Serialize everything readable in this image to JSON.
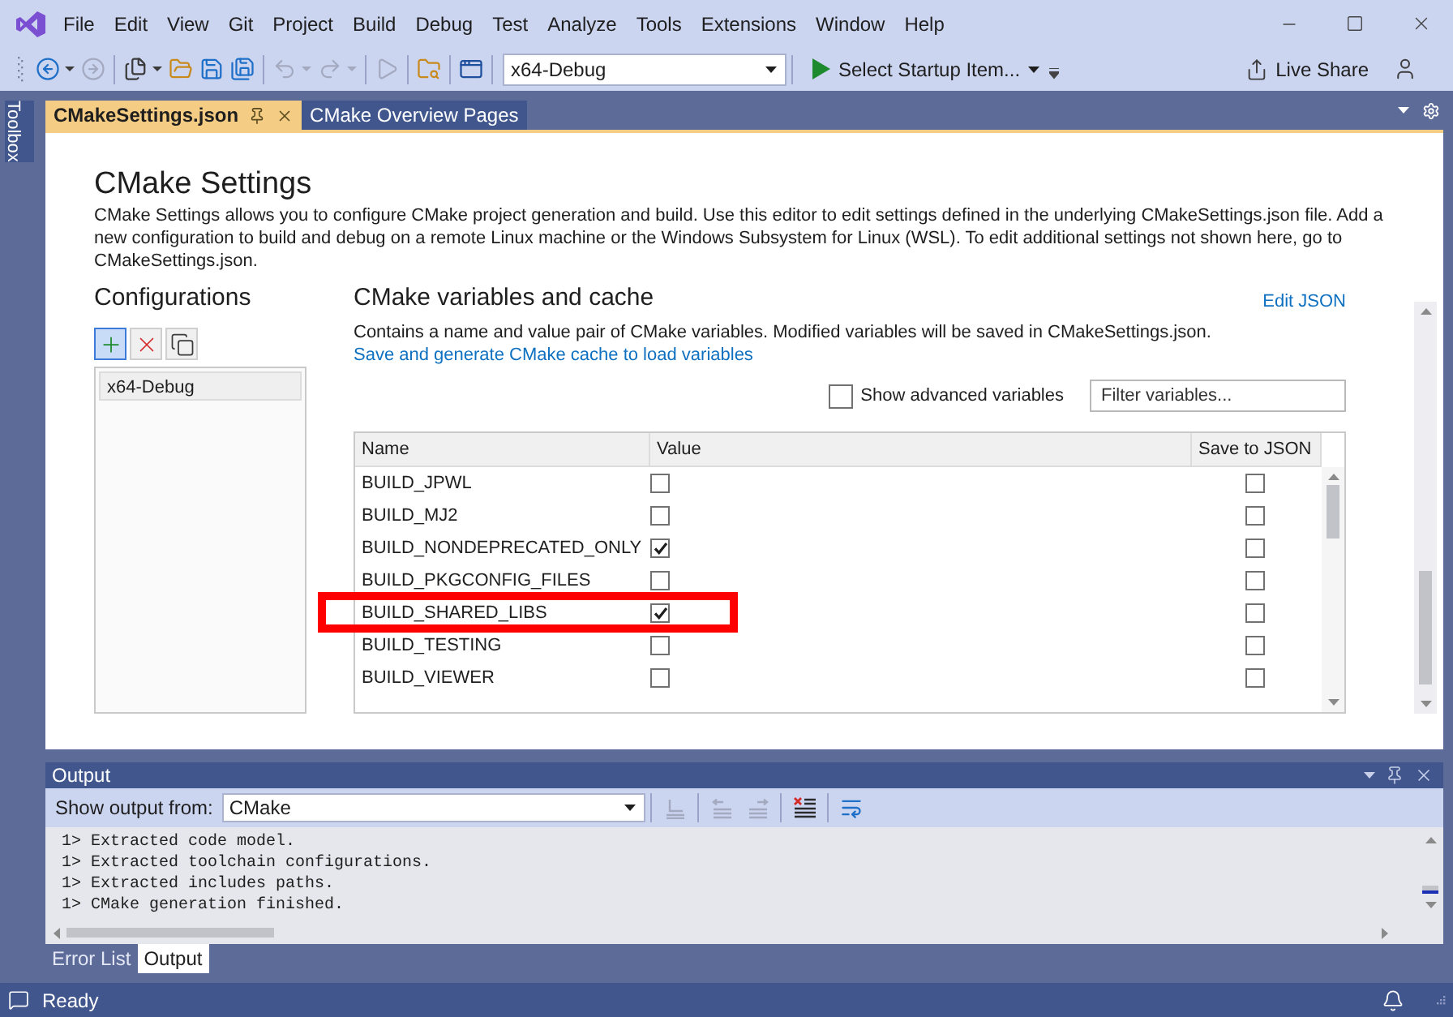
{
  "window": {
    "menu": [
      "File",
      "Edit",
      "View",
      "Git",
      "Project",
      "Build",
      "Debug",
      "Test",
      "Analyze",
      "Tools",
      "Extensions",
      "Window",
      "Help"
    ]
  },
  "toolbar": {
    "buttons": [
      {
        "kind": "back",
        "disabled": false
      },
      {
        "kind": "forward",
        "disabled": true
      },
      {
        "kind": "new",
        "disabled": false
      },
      {
        "kind": "open",
        "disabled": false
      },
      {
        "kind": "save",
        "disabled": false
      },
      {
        "kind": "save_all",
        "disabled": false
      },
      {
        "kind": "undo",
        "disabled": true
      },
      {
        "kind": "redo",
        "disabled": true
      },
      {
        "kind": "start",
        "disabled": true
      },
      {
        "kind": "folder_view",
        "disabled": false
      },
      {
        "kind": "layout",
        "disabled": false
      }
    ],
    "configuration": "x64-Debug",
    "startup_item": "Select Startup Item...",
    "live_share": "Live Share"
  },
  "side_tabs": [
    "Toolbox"
  ],
  "document_tabs": [
    {
      "label": "CMakeSettings.json",
      "selected": true
    },
    {
      "label": "CMake Overview Pages",
      "selected": false
    }
  ],
  "settings": {
    "title": "CMake Settings",
    "description": "CMake Settings allows you to configure CMake project generation and build. Use this editor to edit settings defined in the underlying CMakeSettings.json file. Add a new configuration to build and debug on a remote Linux machine or the Windows Subsystem for Linux (WSL). To edit additional settings not shown here, go to CMakeSettings.json.",
    "configurations": {
      "heading": "Configurations",
      "buttons": [
        {
          "kind": "add",
          "active": true
        },
        {
          "kind": "remove",
          "active": false
        },
        {
          "kind": "copy",
          "active": false
        }
      ],
      "items": [
        {
          "label": "x64-Debug",
          "selected": true
        }
      ]
    },
    "variables": {
      "heading": "CMake variables and cache",
      "edit_link": "Edit JSON",
      "description": "Contains a name and value pair of CMake variables. Modified variables will be saved in CMakeSettings.json.",
      "generate_link": "Save and generate CMake cache to load variables",
      "show_advanced": {
        "label": "Show advanced variables",
        "checked": false
      },
      "filter": {
        "placeholder": "Filter variables..."
      },
      "table": {
        "columns": [
          "Name",
          "Value",
          "Save to JSON"
        ],
        "rows": [
          {
            "name": "BUILD_JPWL",
            "value": false,
            "save": false,
            "highlighted": false
          },
          {
            "name": "BUILD_MJ2",
            "value": false,
            "save": false,
            "highlighted": false
          },
          {
            "name": "BUILD_NONDEPRECATED_ONLY",
            "value": true,
            "save": false,
            "highlighted": false
          },
          {
            "name": "BUILD_PKGCONFIG_FILES",
            "value": false,
            "save": false,
            "highlighted": false
          },
          {
            "name": "BUILD_SHARED_LIBS",
            "value": true,
            "save": false,
            "highlighted": true
          },
          {
            "name": "BUILD_TESTING",
            "value": false,
            "save": false,
            "highlighted": false
          },
          {
            "name": "BUILD_VIEWER",
            "value": false,
            "save": false,
            "highlighted": false
          }
        ]
      }
    }
  },
  "output": {
    "title": "Output",
    "source_label": "Show output from:",
    "source": "CMake",
    "buttons": [
      {
        "kind": "find",
        "disabled": true
      },
      {
        "kind": "prev",
        "disabled": true
      },
      {
        "kind": "next",
        "disabled": true
      },
      {
        "kind": "clear",
        "disabled": false
      },
      {
        "kind": "wrap",
        "disabled": false
      }
    ],
    "lines": [
      "1> Extracted code model.",
      "1> Extracted toolchain configurations.",
      "1> Extracted includes paths.",
      "1> CMake generation finished."
    ]
  },
  "tool_tabs": [
    {
      "label": "Error List",
      "selected": false
    },
    {
      "label": "Output",
      "selected": true
    }
  ],
  "status_bar": {
    "text": "Ready"
  }
}
